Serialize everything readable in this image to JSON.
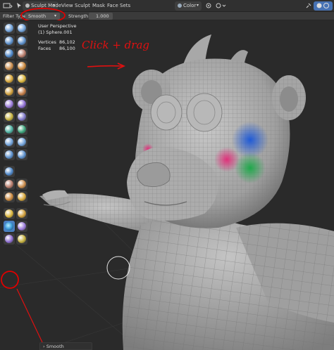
{
  "header": {
    "mode": "Sculpt Mode",
    "menus": [
      "View",
      "Sculpt",
      "Mask",
      "Face Sets"
    ],
    "color_label": "Color"
  },
  "tool_settings": {
    "filter_type_label": "Filter Type",
    "filter_type_value": "Smooth",
    "strength_label": "Strength",
    "strength_value": "1.000"
  },
  "viewport": {
    "perspective": "User Perspective",
    "object": "(1) Sphere.001",
    "stats": [
      {
        "label": "Vertices",
        "value": "86,102"
      },
      {
        "label": "Faces",
        "value": "86,100"
      }
    ],
    "annotation": "Click + drag"
  },
  "operator_panel": {
    "label": "Smooth"
  },
  "colors": {
    "highlight_circle": "#e00000",
    "active_tool": "#4a7fc1",
    "model_gray": "#a9a9a9"
  },
  "icons": [
    "menu-icon",
    "cursor-icon",
    "sculpt-mode-icon",
    "view-icon",
    "color-sphere-icon",
    "overlay-icon",
    "shading-icon"
  ]
}
